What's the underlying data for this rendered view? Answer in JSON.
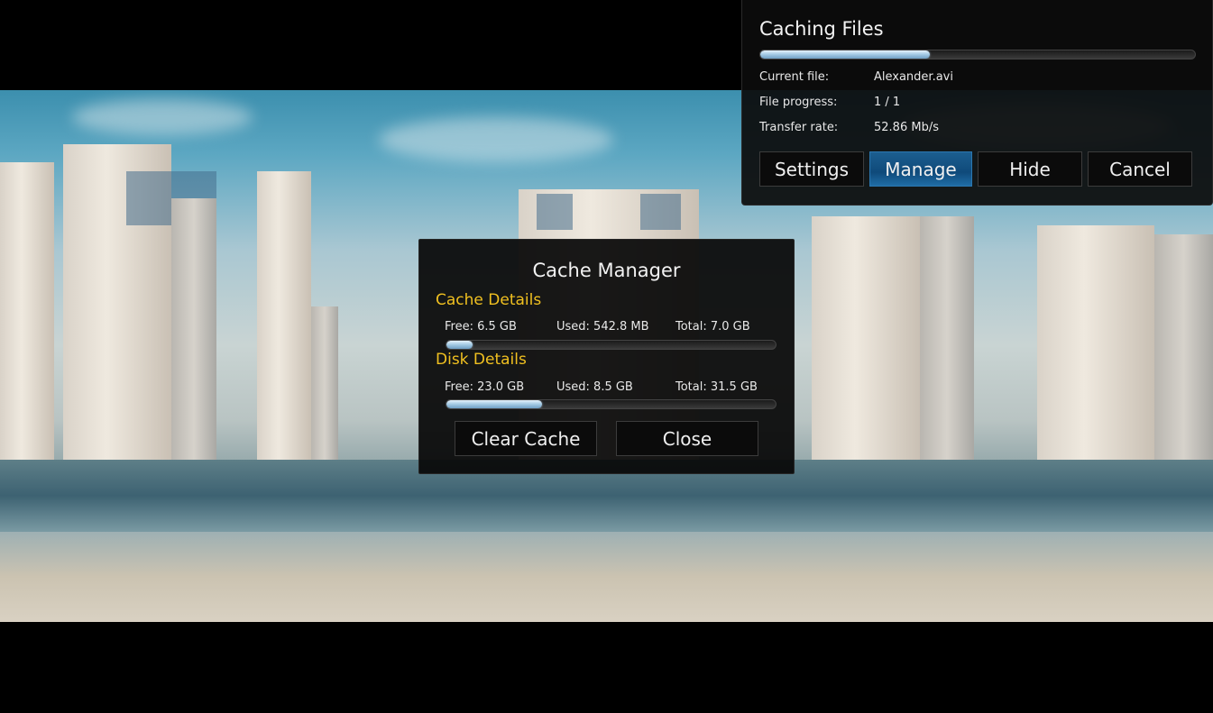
{
  "caching_panel": {
    "title": "Caching Files",
    "progress": 0.39,
    "current_file_label": "Current file:",
    "current_file_value": "Alexander.avi",
    "file_progress_label": "File progress:",
    "file_progress_value": "1 / 1",
    "transfer_rate_label": "Transfer rate:",
    "transfer_rate_value": "52.86 Mb/s",
    "buttons": {
      "settings": "Settings",
      "manage": "Manage",
      "hide": "Hide",
      "cancel": "Cancel"
    },
    "active_button": "manage"
  },
  "cache_manager": {
    "title": "Cache Manager",
    "cache_details": {
      "heading": "Cache Details",
      "free": "Free: 6.5 GB",
      "used": "Used: 542.8 MB",
      "total": "Total: 7.0 GB",
      "usage": 0.08
    },
    "disk_details": {
      "heading": "Disk Details",
      "free": "Free: 23.0 GB",
      "used": "Used: 8.5 GB",
      "total": "Total: 31.5 GB",
      "usage": 0.29
    },
    "buttons": {
      "clear_cache": "Clear Cache",
      "close": "Close"
    }
  },
  "colors": {
    "section_heading": "#f0c020",
    "active_button": "#1c5e90",
    "panel_background": "#0c0c0c",
    "progress_fill": "#a8cde6"
  }
}
